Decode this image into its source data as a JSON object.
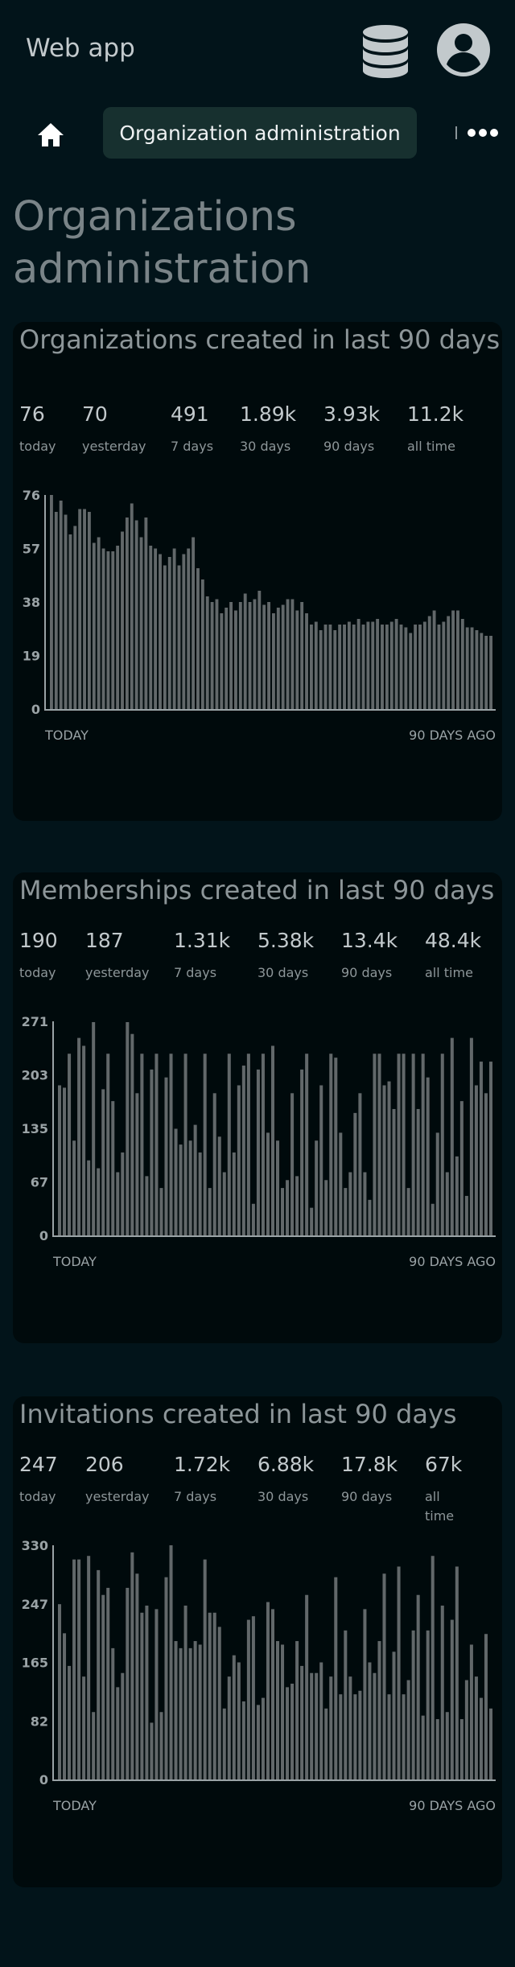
{
  "header": {
    "app_title": "Web app",
    "icons": [
      "database-icon",
      "user-avatar-icon"
    ]
  },
  "nav": {
    "home_icon": "home-icon",
    "breadcrumb": "Organization administration",
    "more_icon": "more-horizontal-icon"
  },
  "page": {
    "title": "Organizations administration"
  },
  "colors": {
    "background": "#02141a",
    "card": "#000a0c",
    "breadcrumb_bg": "#17302f",
    "bar": "#62686a"
  },
  "cards": [
    {
      "title": "Organizations created in last 90 days",
      "stats": [
        {
          "value": "76",
          "label": "today"
        },
        {
          "value": "70",
          "label": "yesterday"
        },
        {
          "value": "491",
          "label": "7 days"
        },
        {
          "value": "1.89k",
          "label": "30 days"
        },
        {
          "value": "3.93k",
          "label": "90 days"
        },
        {
          "value": "11.2k",
          "label": "all time"
        }
      ],
      "x_start_label": "TODAY",
      "x_end_label": "90 DAYS AGO"
    },
    {
      "title": "Memberships created in last 90 days",
      "stats": [
        {
          "value": "190",
          "label": "today"
        },
        {
          "value": "187",
          "label": "yesterday"
        },
        {
          "value": "1.31k",
          "label": "7 days"
        },
        {
          "value": "5.38k",
          "label": "30 days"
        },
        {
          "value": "13.4k",
          "label": "90 days"
        },
        {
          "value": "48.4k",
          "label": "all time"
        }
      ],
      "x_start_label": "TODAY",
      "x_end_label": "90 DAYS AGO"
    },
    {
      "title": "Invitations created in last 90 days",
      "stats": [
        {
          "value": "247",
          "label": "today"
        },
        {
          "value": "206",
          "label": "yesterday"
        },
        {
          "value": "1.72k",
          "label": "7 days"
        },
        {
          "value": "6.88k",
          "label": "30 days"
        },
        {
          "value": "17.8k",
          "label": "90 days"
        },
        {
          "value": "67k",
          "label": "all time"
        }
      ],
      "x_start_label": "TODAY",
      "x_end_label": "90 DAYS AGO"
    }
  ],
  "chart_data": [
    {
      "type": "bar",
      "ylim": [
        0,
        76
      ],
      "yticks": [
        "0",
        "19",
        "38",
        "57",
        "76"
      ],
      "xlabel_start": "TODAY",
      "xlabel_end": "90 DAYS AGO",
      "values": [
        76,
        70,
        74,
        69,
        62,
        65,
        71,
        71,
        70,
        59,
        61,
        57,
        56,
        56,
        58,
        63,
        68,
        73,
        67,
        61,
        68,
        58,
        57,
        55,
        51,
        54,
        57,
        51,
        55,
        57,
        61,
        50,
        46,
        40,
        38,
        39,
        34,
        36,
        38,
        35,
        38,
        41,
        38,
        39,
        42,
        37,
        38,
        34,
        36,
        37,
        39,
        39,
        35,
        38,
        34,
        30,
        31,
        28,
        30,
        30,
        28,
        30,
        30,
        31,
        30,
        32,
        30,
        31,
        31,
        32,
        30,
        30,
        31,
        32,
        30,
        29,
        27,
        30,
        30,
        31,
        33,
        35,
        30,
        31,
        33,
        35,
        35,
        32,
        29,
        29,
        28,
        27,
        26,
        26
      ]
    },
    {
      "type": "bar",
      "ylim": [
        0,
        271
      ],
      "yticks": [
        "0",
        "67",
        "135",
        "203",
        "271"
      ],
      "xlabel_start": "TODAY",
      "xlabel_end": "90 DAYS AGO",
      "values": [
        190,
        187,
        230,
        120,
        250,
        240,
        95,
        270,
        85,
        185,
        230,
        170,
        80,
        105,
        270,
        255,
        180,
        230,
        75,
        210,
        230,
        60,
        200,
        230,
        135,
        115,
        230,
        120,
        140,
        105,
        230,
        60,
        180,
        125,
        80,
        230,
        105,
        190,
        215,
        230,
        40,
        210,
        230,
        130,
        240,
        120,
        60,
        70,
        180,
        75,
        210,
        230,
        35,
        120,
        190,
        70,
        230,
        225,
        130,
        60,
        80,
        155,
        180,
        80,
        45,
        230,
        230,
        190,
        195,
        160,
        230,
        230,
        60,
        230,
        160,
        230,
        200,
        40,
        130,
        230,
        80,
        250,
        100,
        170,
        50,
        250,
        190,
        220,
        180,
        220
      ]
    },
    {
      "type": "bar",
      "ylim": [
        0,
        330
      ],
      "yticks": [
        "0",
        "82",
        "165",
        "247",
        "330"
      ],
      "xlabel_start": "TODAY",
      "xlabel_end": "90 DAYS AGO",
      "values": [
        247,
        206,
        160,
        310,
        310,
        145,
        315,
        95,
        295,
        260,
        270,
        185,
        130,
        150,
        270,
        320,
        290,
        235,
        245,
        80,
        240,
        95,
        285,
        330,
        195,
        185,
        245,
        185,
        195,
        190,
        310,
        235,
        235,
        215,
        100,
        145,
        175,
        165,
        110,
        225,
        230,
        105,
        115,
        250,
        240,
        195,
        190,
        130,
        135,
        195,
        160,
        260,
        150,
        150,
        165,
        100,
        145,
        285,
        120,
        210,
        145,
        120,
        125,
        240,
        165,
        150,
        195,
        290,
        120,
        180,
        300,
        120,
        140,
        210,
        260,
        90,
        210,
        315,
        85,
        245,
        95,
        225,
        300,
        85,
        140,
        190,
        145,
        115,
        205,
        100
      ]
    }
  ]
}
